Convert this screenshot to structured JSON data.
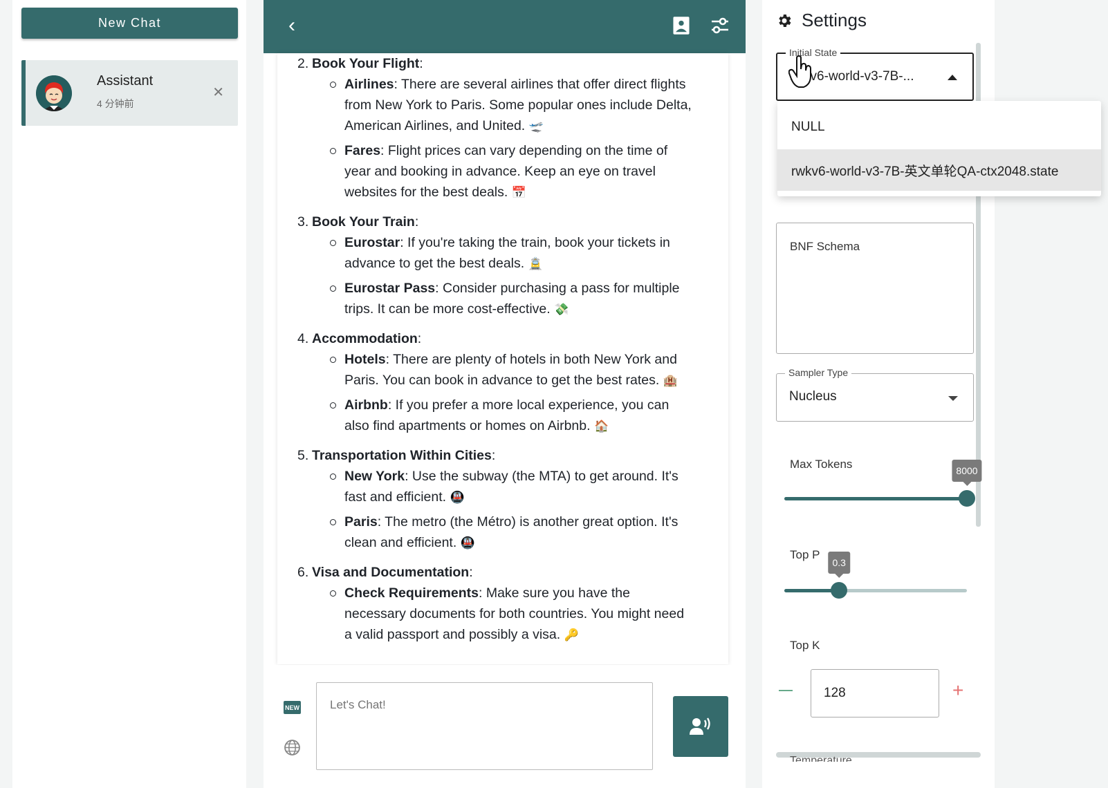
{
  "sidebar": {
    "new_chat_label": "New Chat",
    "sessions": [
      {
        "name": "Assistant",
        "time": "4 分钟前"
      }
    ]
  },
  "chat": {
    "messages": [
      {
        "num": "2.",
        "title": "Book Your Flight",
        "items": [
          {
            "label": "Airlines",
            "text": ": There are several airlines that offer direct flights from New York to Paris. Some popular ones include Delta, American Airlines, and United.",
            "emoji": "🛫"
          },
          {
            "label": "Fares",
            "text": ": Flight prices can vary depending on the time of year and booking in advance. Keep an eye on travel websites for the best deals.",
            "emoji": "📅"
          }
        ]
      },
      {
        "num": "3.",
        "title": "Book Your Train",
        "items": [
          {
            "label": "Eurostar",
            "text": ": If you're taking the train, book your tickets in advance to get the best deals.",
            "emoji": "🚊"
          },
          {
            "label": "Eurostar Pass",
            "text": ": Consider purchasing a pass for multiple trips. It can be more cost-effective.",
            "emoji": "💸"
          }
        ]
      },
      {
        "num": "4.",
        "title": "Accommodation",
        "items": [
          {
            "label": "Hotels",
            "text": ": There are plenty of hotels in both New York and Paris. You can book in advance to get the best rates.",
            "emoji": "🏨"
          },
          {
            "label": "Airbnb",
            "text": ": If you prefer a more local experience, you can also find apartments or homes on Airbnb.",
            "emoji": "🏠"
          }
        ]
      },
      {
        "num": "5.",
        "title": "Transportation Within Cities",
        "items": [
          {
            "label": "New York",
            "text": ": Use the subway (the MTA) to get around. It's fast and efficient.",
            "emoji": "🚇"
          },
          {
            "label": "Paris",
            "text": ": The metro (the Métro) is another great option. It's clean and efficient.",
            "emoji": "🚇"
          }
        ]
      },
      {
        "num": "6.",
        "title": "Visa and Documentation",
        "items": [
          {
            "label": "Check Requirements",
            "text": ": Make sure you have the necessary documents for both countries. You might need a valid passport and possibly a visa.",
            "emoji": "🔑"
          }
        ]
      }
    ],
    "input_placeholder": "Let's Chat!",
    "new_badge": "NEW"
  },
  "settings": {
    "title": "Settings",
    "initial_state": {
      "label": "Initial State",
      "value": "rwkv6-world-v3-7B-...",
      "options": [
        "NULL",
        "rwkv6-world-v3-7B-英文单轮QA-ctx2048.state"
      ],
      "selected_index": 1
    },
    "bnf_placeholder": "BNF Schema",
    "sampler": {
      "label": "Sampler Type",
      "value": "Nucleus"
    },
    "max_tokens": {
      "label": "Max Tokens",
      "value": "8000",
      "fraction": 1.0
    },
    "top_p": {
      "label": "Top P",
      "value": "0.3",
      "fraction": 0.3
    },
    "top_k": {
      "label": "Top K",
      "value": "128"
    },
    "temperature_label": "Temperature"
  },
  "colors": {
    "accent": "#356b6c",
    "minus": "#66a98a",
    "plus": "#e57373"
  }
}
